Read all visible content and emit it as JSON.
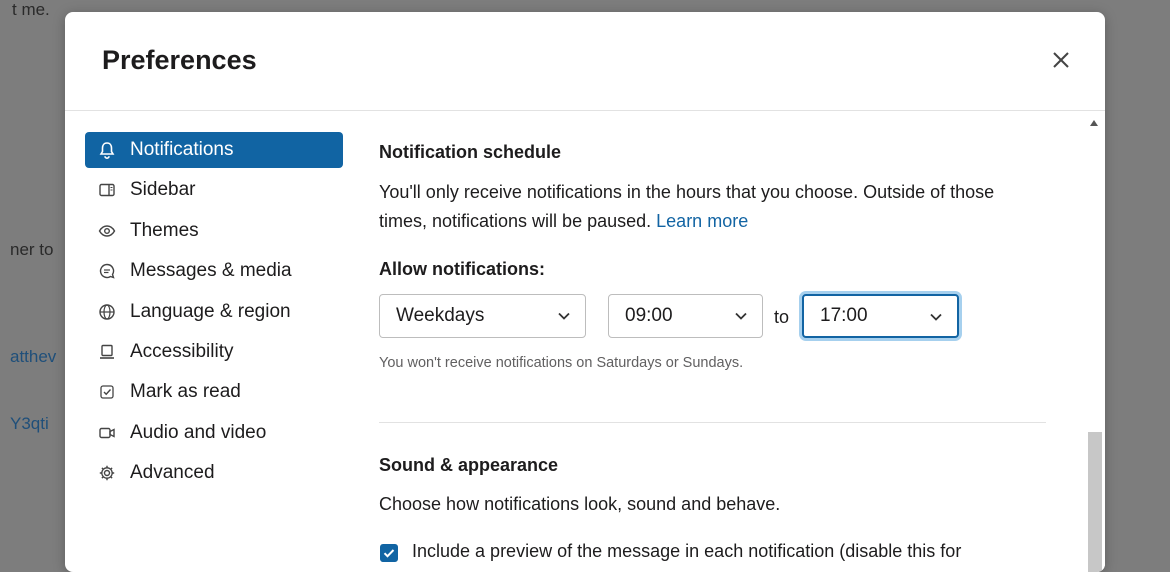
{
  "background": {
    "fragments": [
      "t me.",
      "ner to",
      "atthev",
      "Y3qti"
    ]
  },
  "modal": {
    "title": "Preferences",
    "close_icon": "close-icon"
  },
  "nav": {
    "items": [
      {
        "label": "Notifications",
        "icon": "bell-icon",
        "active": true
      },
      {
        "label": "Sidebar",
        "icon": "sidebar-icon"
      },
      {
        "label": "Themes",
        "icon": "eye-icon"
      },
      {
        "label": "Messages & media",
        "icon": "message-icon"
      },
      {
        "label": "Language & region",
        "icon": "globe-icon"
      },
      {
        "label": "Accessibility",
        "icon": "laptop-icon"
      },
      {
        "label": "Mark as read",
        "icon": "check-square-icon"
      },
      {
        "label": "Audio and video",
        "icon": "video-icon"
      },
      {
        "label": "Advanced",
        "icon": "gear-icon"
      }
    ]
  },
  "schedule": {
    "title": "Notification schedule",
    "desc_line1": "You'll only receive notifications in the hours that you choose. Outside of those",
    "desc_line2_prefix": "times, notifications will be paused.",
    "learn_more": "Learn more",
    "allow_label": "Allow notifications:",
    "days_value": "Weekdays",
    "start_value": "09:00",
    "to_label": "to",
    "end_value": "17:00",
    "hint": "You won't receive notifications on Saturdays or Sundays."
  },
  "sound": {
    "title": "Sound & appearance",
    "desc": "Choose how notifications look, sound and behave.",
    "preview_checkbox_label": "Include a preview of the message in each notification (disable this for",
    "preview_checked": true
  },
  "colors": {
    "accent": "#1164a3",
    "link": "#1264a3",
    "overlay": "#7d7d7d"
  }
}
